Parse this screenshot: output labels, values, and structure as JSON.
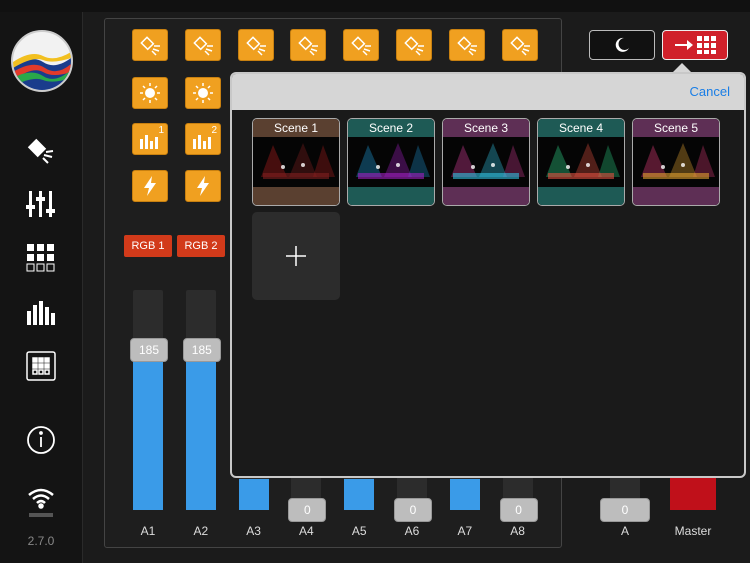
{
  "app": {
    "version": "2.7.0"
  },
  "sidebar": {
    "items": [
      {
        "icon": "spotlight-icon"
      },
      {
        "icon": "faders-icon"
      },
      {
        "icon": "grid-icon"
      },
      {
        "icon": "equalizer-icon"
      },
      {
        "icon": "scene-sequence-icon"
      },
      {
        "icon": "info-icon"
      },
      {
        "icon": "wifi-icon"
      }
    ]
  },
  "top_buttons": {
    "night_mode_icon": "moon-icon",
    "scene_view_icon": "arrow-grid-icon",
    "scene_view_color": "#d0202a"
  },
  "fixture_buttons": {
    "spot_count": 8,
    "group_1_label": "1",
    "group_2_label": "2",
    "accent": "#f0a020"
  },
  "rgb_buttons": [
    "RGB 1",
    "RGB 2"
  ],
  "channels": [
    {
      "label": "A1",
      "value": "185",
      "level": 0.73
    },
    {
      "label": "A2",
      "value": "185",
      "level": 0.73
    },
    {
      "label": "A3",
      "value": "",
      "level": 0.14
    },
    {
      "label": "A4",
      "value": "0",
      "level": 0
    },
    {
      "label": "A5",
      "value": "",
      "level": 0.14
    },
    {
      "label": "A6",
      "value": "0",
      "level": 0
    },
    {
      "label": "A7",
      "value": "",
      "level": 0.14
    },
    {
      "label": "A8",
      "value": "0",
      "level": 0
    }
  ],
  "masters": [
    {
      "label": "A",
      "value": "0"
    },
    {
      "label": "Master",
      "value": ""
    }
  ],
  "scene_popover": {
    "cancel_label": "Cancel",
    "scenes": [
      {
        "name": "Scene 1",
        "header_color": "#5a4030",
        "footer_color": "#5a4030"
      },
      {
        "name": "Scene 2",
        "header_color": "#1e5a55",
        "footer_color": "#1e5a55"
      },
      {
        "name": "Scene 3",
        "header_color": "#5e2f55",
        "footer_color": "#5e2f55"
      },
      {
        "name": "Scene 4",
        "header_color": "#1e5a55",
        "footer_color": "#1e5a55"
      },
      {
        "name": "Scene 5",
        "header_color": "#5e2f55",
        "footer_color": "#5e2f55"
      }
    ],
    "add_icon": "plus-icon"
  }
}
